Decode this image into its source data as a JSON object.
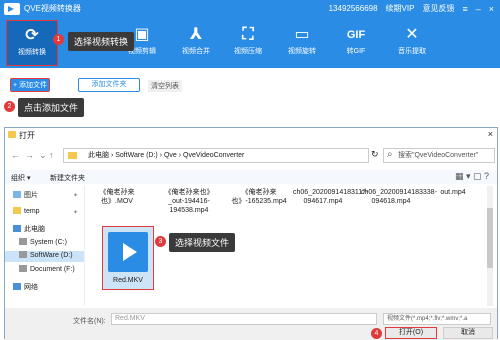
{
  "app": {
    "title": "QVE视频转换器",
    "phone": "13492566698",
    "vip": "续期VIP",
    "feedback": "意见反馈",
    "win_controls": [
      "≡",
      "–",
      "×"
    ]
  },
  "toolbar": {
    "tools": [
      {
        "label": "视频转换",
        "icon": "convert-icon",
        "glyph": "⟳"
      },
      {
        "label": "视频剪辑",
        "icon": "video-edit-icon",
        "glyph": "▣"
      },
      {
        "label": "视频合并",
        "icon": "merge-icon",
        "glyph": "⅄"
      },
      {
        "label": "视频压缩",
        "icon": "compress-icon",
        "glyph": "⛶"
      },
      {
        "label": "视频旋转",
        "icon": "rotate-icon",
        "glyph": "▭"
      },
      {
        "label": "转GIF",
        "icon": "gif-icon",
        "glyph": "GIF"
      },
      {
        "label": "音乐提取",
        "icon": "music-extract-icon",
        "glyph": "✕"
      }
    ]
  },
  "callouts": {
    "step1": {
      "num": "1",
      "text": "选择视频转换"
    },
    "step2": {
      "num": "2",
      "text": "点击添加文件"
    },
    "step3": {
      "num": "3",
      "text": "选择视频文件"
    },
    "step4": {
      "num": "4"
    }
  },
  "actions": {
    "add_file": "+ 添加文件",
    "add_folder": "添加文件夹",
    "clear_list": "清空列表"
  },
  "dialog": {
    "title": "打开",
    "close": "×",
    "address": "此电脑 › SoftWare (D:) › Qve › QveVideoConverter",
    "search_placeholder": "搜索\"QveVideoConverter\"",
    "organize": "组织 ▾",
    "new_folder": "新建文件夹",
    "sidebar": [
      {
        "label": "图片",
        "icon": "pictures-icon"
      },
      {
        "label": "temp",
        "icon": "folder-icon"
      },
      {
        "label": "此电脑",
        "icon": "computer-icon"
      },
      {
        "label": "System (C:)",
        "icon": "drive-icon"
      },
      {
        "label": "SoftWare (D:)",
        "icon": "drive-icon"
      },
      {
        "label": "Document (F:)",
        "icon": "drive-icon"
      },
      {
        "label": "网络",
        "icon": "network-icon"
      }
    ],
    "files_top": [
      "《俺老孙来也》.MOV",
      "《俺老孙来也》_out-194416-194538.mp4",
      "《俺老孙来也》-165235.mp4",
      "ch06_20200914183117-094617.mp4",
      "ch06_20200914183338-094618.mp4",
      "out.mp4"
    ],
    "selected_file": "Red.MKV",
    "filename_label": "文件名(N):",
    "filename_value": "Red.MKV",
    "filetype": "视频文件(*.mp4;*.flv;*.wmv;*.a",
    "open": "打开(O)",
    "cancel": "取消"
  },
  "colors": {
    "brand": "#2b8ce6",
    "accent": "#e23a3a"
  }
}
